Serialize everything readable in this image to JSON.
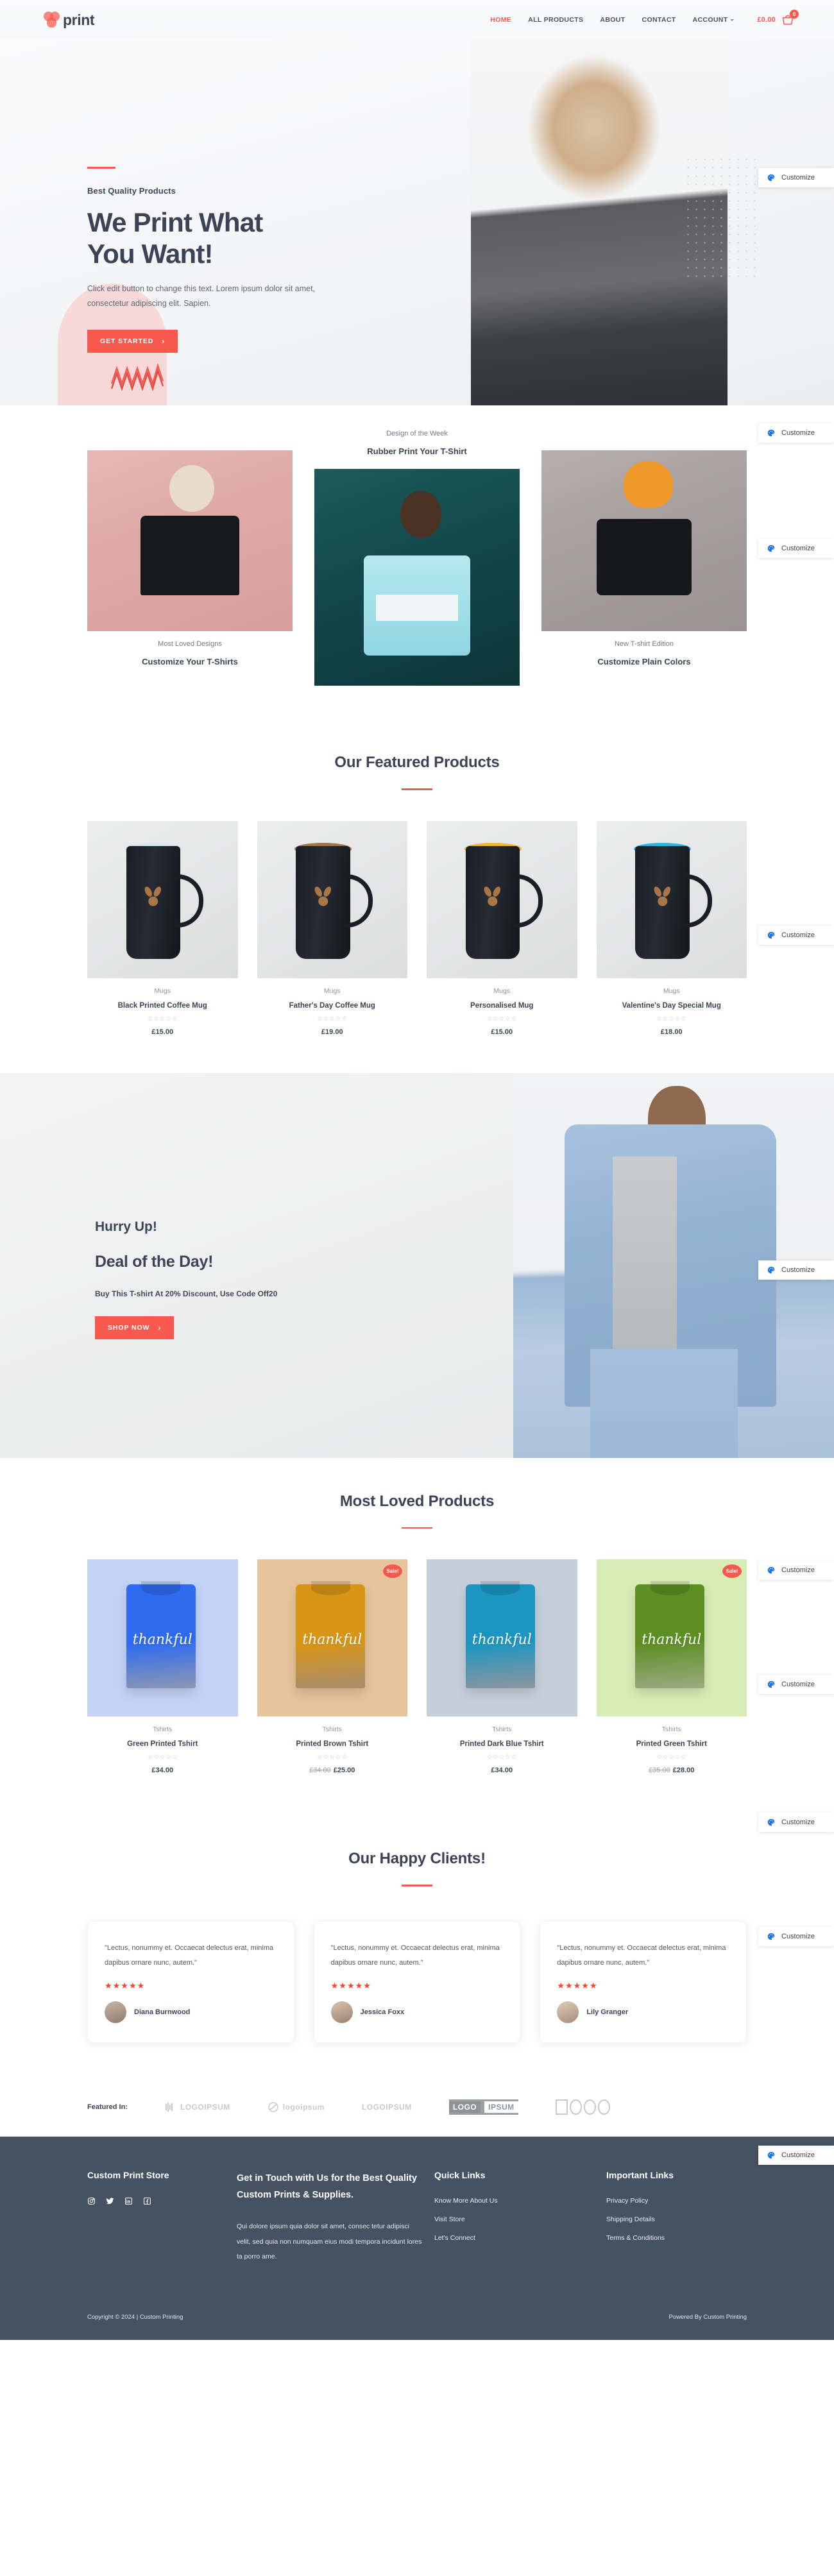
{
  "theme": {
    "accent": "#f8594e",
    "ink": "#3b4456",
    "muted": "#8b93a1",
    "footer_bg": "#445261",
    "customize_icon_color": "#1a73e8"
  },
  "header": {
    "logo_text": "print",
    "nav": [
      {
        "label": "HOME",
        "active": true
      },
      {
        "label": "ALL PRODUCTS",
        "active": false
      },
      {
        "label": "ABOUT",
        "active": false
      },
      {
        "label": "CONTACT",
        "active": false
      },
      {
        "label": "ACCOUNT",
        "active": false,
        "has_caret": true
      }
    ],
    "cart_total": "£0.00",
    "cart_count": "0"
  },
  "customize": {
    "label": "Customize",
    "icon": "palette-icon"
  },
  "hero": {
    "kicker": "Best Quality Products",
    "title_line1": "We Print What",
    "title_line2": "You Want!",
    "subtitle": "Click edit button to change this text. Lorem ipsum dolor sit amet, consectetur adipiscing elit. Sapien.",
    "cta": "GET STARTED",
    "cta_chevron": "›"
  },
  "design_section": {
    "left": {
      "caption": "Most Loved Designs",
      "title": "Customize Your T-Shirts"
    },
    "middle": {
      "caption": "Design of the Week",
      "title": "Rubber Print Your T-Shirt"
    },
    "right": {
      "caption": "New T-shirt Edition",
      "title": "Customize Plain Colors"
    }
  },
  "featured_products": {
    "heading": "Our Featured Products",
    "items": [
      {
        "category": "Mugs",
        "name": "Black Printed Coffee Mug",
        "stars": "☆☆☆☆☆",
        "price": "£15.00",
        "old_price": "",
        "sale": false,
        "rim": "#dbe6ee"
      },
      {
        "category": "Mugs",
        "name": "Father's Day Coffee Mug",
        "stars": "☆☆☆☆☆",
        "price": "£19.00",
        "old_price": "",
        "sale": false,
        "rim": "#a5754a"
      },
      {
        "category": "Mugs",
        "name": "Personalised Mug",
        "stars": "☆☆☆☆☆",
        "price": "£15.00",
        "old_price": "",
        "sale": false,
        "rim": "#f5b437"
      },
      {
        "category": "Mugs",
        "name": "Valentine's Day Special Mug",
        "stars": "☆☆☆☆☆",
        "price": "£18.00",
        "old_price": "",
        "sale": false,
        "rim": "#31b4e0"
      }
    ]
  },
  "deal": {
    "hurry": "Hurry Up!",
    "title": "Deal of the Day!",
    "note": "Buy This T-shirt At 20% Discount, Use Code Off20",
    "cta": "SHOP NOW",
    "cta_chevron": "›"
  },
  "most_loved": {
    "heading": "Most Loved Products",
    "sale_label": "Sale!",
    "items": [
      {
        "category": "Tshirts",
        "name": "Green Printed Tshirt",
        "stars": "☆☆☆☆☆",
        "price": "£34.00",
        "old_price": "",
        "sale": false,
        "bg": "#c3d2f7",
        "shirt": "#2f6bf0",
        "word": "thankful"
      },
      {
        "category": "Tshirts",
        "name": "Printed Brown Tshirt",
        "stars": "☆☆☆☆☆",
        "price": "£25.00",
        "old_price": "£34.00",
        "sale": true,
        "bg": "#e7c49b",
        "shirt": "#d89516",
        "word": "thankful"
      },
      {
        "category": "Tshirts",
        "name": "Printed Dark Blue Tshirt",
        "stars": "☆☆☆☆☆",
        "price": "£34.00",
        "old_price": "",
        "sale": false,
        "bg": "#c5cfdb",
        "shirt": "#1b96c2",
        "word": "thankful"
      },
      {
        "category": "Tshirts",
        "name": "Printed Green Tshirt",
        "stars": "☆☆☆☆☆",
        "price": "£28.00",
        "old_price": "£35.00",
        "sale": true,
        "bg": "#d8ecb5",
        "shirt": "#5d8f23",
        "word": "thankful"
      }
    ]
  },
  "testimonials": {
    "heading": "Our Happy Clients!",
    "items": [
      {
        "quote": "\"Lectus, nonummy et. Occaecat delectus erat, minima dapibus ornare nunc, autem.\"",
        "stars": "★★★★",
        "half": "★",
        "name": "Diana Burnwood"
      },
      {
        "quote": "\"Lectus, nonummy et. Occaecat delectus erat, minima dapibus ornare nunc, autem.\"",
        "stars": "★★★★★",
        "half": "",
        "name": "Jessica Foxx"
      },
      {
        "quote": "\"Lectus, nonummy et. Occaecat delectus erat, minima dapibus ornare nunc, autem.\"",
        "stars": "★★★★★",
        "half": "",
        "name": "Lily Granger"
      }
    ]
  },
  "featured_in": {
    "label": "Featured In:",
    "logos": [
      {
        "name": "logoipsum-bars",
        "text": "LOGOIPSUM"
      },
      {
        "name": "logoipsum-swirl",
        "text": "logoipsum"
      },
      {
        "name": "logoipsum-plain",
        "text": "LOGOIPSUM"
      },
      {
        "name": "logoipsum-boxed-left",
        "text": "LOGO"
      },
      {
        "name": "logoipsum-boxed-right",
        "text": "IPSUM"
      },
      {
        "name": "logoipsum-outline",
        "text": "LOGO"
      }
    ]
  },
  "footer": {
    "brand_title": "Custom Print Store",
    "socials": [
      "instagram-icon",
      "twitter-icon",
      "linkedin-icon",
      "facebook-icon"
    ],
    "contact_heading": "Get in Touch with Us for the Best Quality Custom Prints & Supplies.",
    "contact_para": "Qui dolore ipsum quia dolor sit amet, consec tetur adipisci velit, sed quia non numquam eius modi tempora incidunt lores ta porro ame.",
    "quick_links_title": "Quick Links",
    "quick_links": [
      "Know More About Us",
      "Visit Store",
      "Let's Connect"
    ],
    "important_links_title": "Important Links",
    "important_links": [
      "Privacy Policy",
      "Shipping Details",
      "Terms & Conditions"
    ],
    "copyright": "Copyright © 2024 | Custom Printing",
    "powered_by": "Powered By Custom Printing"
  }
}
